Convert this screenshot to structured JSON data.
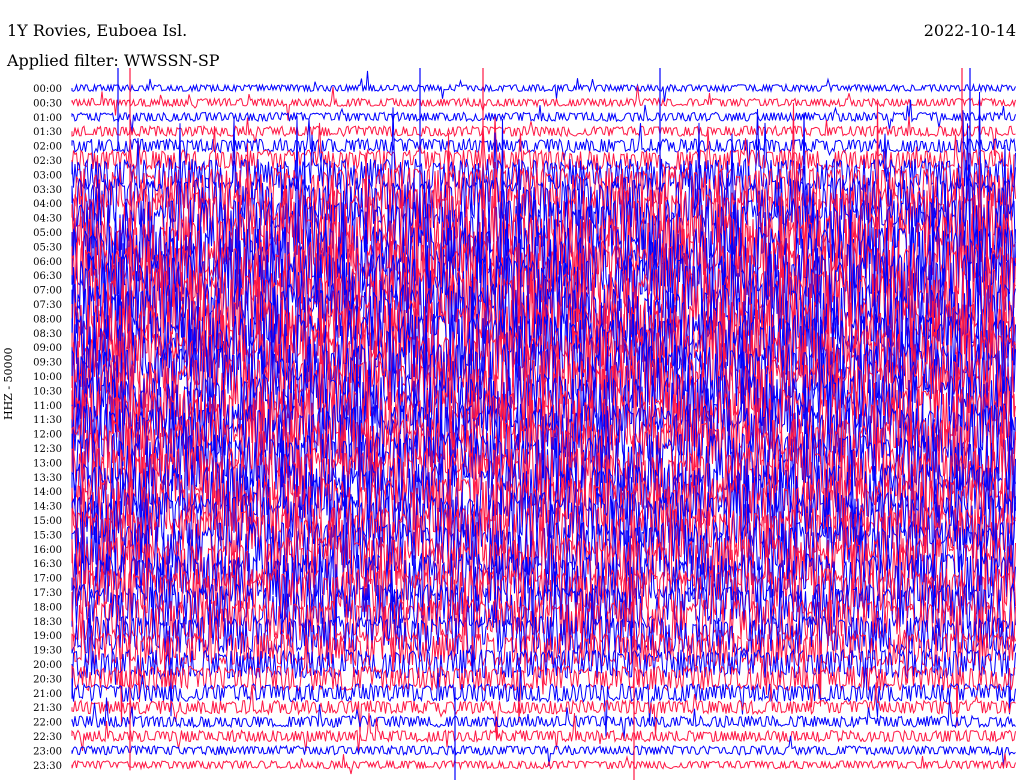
{
  "header": {
    "station": "1Y Rovies, Euboea Isl.",
    "date": "2022-10-14",
    "filter": "Applied filter: WWSSN-SP"
  },
  "channel_label": "HHZ - 50000",
  "colors": {
    "trace_a": "#0000ff",
    "trace_b": "#ff1744",
    "background": "#ffffff"
  },
  "chart_data": {
    "type": "line",
    "title": "1Y Rovies, Euboea Isl.",
    "subtitle": "Applied filter: WWSSN-SP",
    "date": "2022-10-14",
    "ylabel": "HHZ - 50000",
    "categories": [
      "00:00",
      "00:30",
      "01:00",
      "01:30",
      "02:00",
      "02:30",
      "03:00",
      "03:30",
      "04:00",
      "04:30",
      "05:00",
      "05:30",
      "06:00",
      "06:30",
      "07:00",
      "07:30",
      "08:00",
      "08:30",
      "09:00",
      "09:30",
      "10:00",
      "10:30",
      "11:00",
      "11:30",
      "12:00",
      "12:30",
      "13:00",
      "13:30",
      "14:00",
      "14:30",
      "15:00",
      "15:30",
      "16:00",
      "16:30",
      "17:00",
      "17:30",
      "18:00",
      "18:30",
      "19:00",
      "19:30",
      "20:00",
      "20:30",
      "21:00",
      "21:30",
      "22:00",
      "22:30",
      "23:00",
      "23:30"
    ],
    "trace_colors_alternate": [
      "#0000ff",
      "#ff1744"
    ],
    "relative_amplitude": [
      0.3,
      0.35,
      0.4,
      0.45,
      0.6,
      0.9,
      1.4,
      1.9,
      2.3,
      2.6,
      2.9,
      3.0,
      3.1,
      3.1,
      3.2,
      3.2,
      3.1,
      3.0,
      3.0,
      2.9,
      2.9,
      2.8,
      2.8,
      2.7,
      2.7,
      2.6,
      2.6,
      2.6,
      2.5,
      2.5,
      2.5,
      2.4,
      2.4,
      2.3,
      2.2,
      2.1,
      2.0,
      1.9,
      1.7,
      1.5,
      1.3,
      1.1,
      0.8,
      0.6,
      0.5,
      0.5,
      0.4,
      0.35
    ],
    "grid": false
  }
}
